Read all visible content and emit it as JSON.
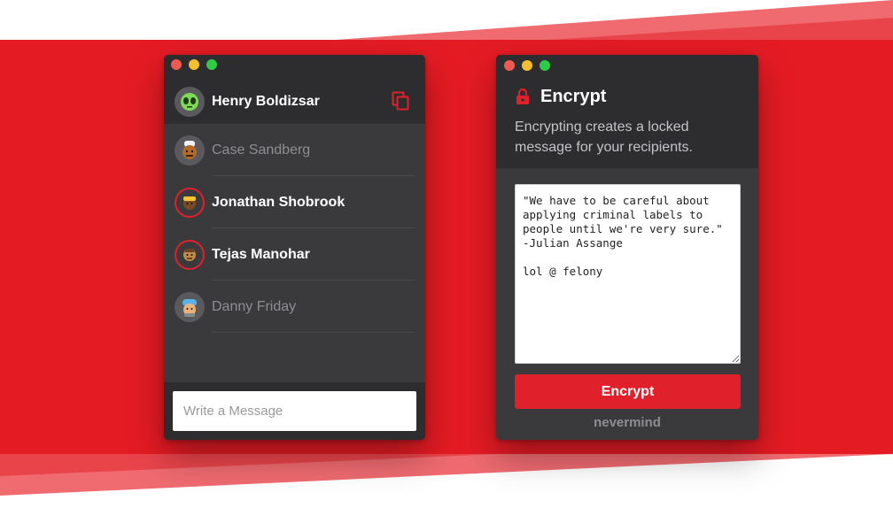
{
  "colors": {
    "accent": "#e0212b",
    "panel_dark": "#2d2d30",
    "panel_mid": "#3a3a3d",
    "text_dim": "#8e8e92"
  },
  "chat": {
    "header": {
      "name": "Henry Boldizsar",
      "copy_icon": "copy-icon"
    },
    "contacts": [
      {
        "name": "Case Sandberg",
        "selected": false
      },
      {
        "name": "Jonathan Shobrook",
        "selected": true
      },
      {
        "name": "Tejas Manohar",
        "selected": true
      },
      {
        "name": "Danny Friday",
        "selected": false
      }
    ],
    "compose": {
      "placeholder": "Write a Message",
      "value": ""
    }
  },
  "encrypt": {
    "title": "Encrypt",
    "lock_icon": "lock-icon",
    "description": "Encrypting creates a locked message for your recipients.",
    "message": "\"We have to be careful about applying criminal labels to people until we're very sure.\" -Julian Assange\n\nlol @ felony",
    "button_label": "Encrypt",
    "cancel_label": "nevermind"
  }
}
